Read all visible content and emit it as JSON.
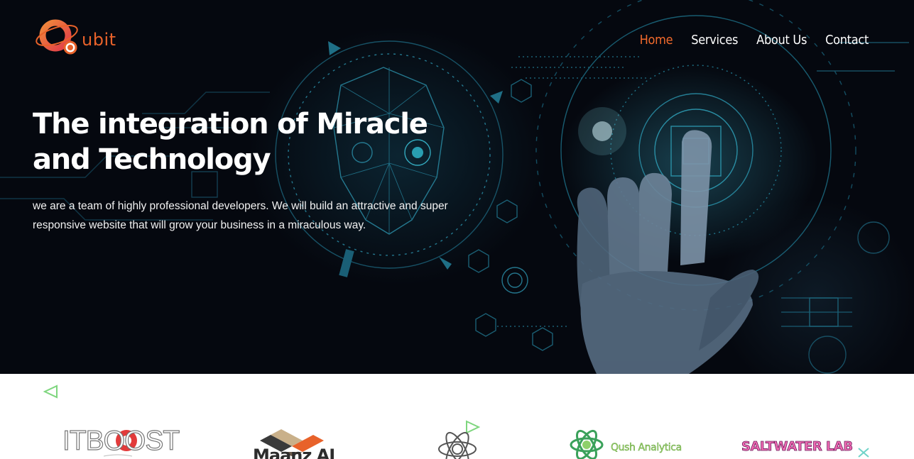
{
  "brand": {
    "name": "ubit",
    "color": "#e8622a"
  },
  "nav": {
    "items": [
      {
        "label": "Home",
        "active": true
      },
      {
        "label": "Services",
        "active": false
      },
      {
        "label": "About Us",
        "active": false
      },
      {
        "label": "Contact",
        "active": false
      }
    ],
    "active_color": "#f26a2c"
  },
  "hero": {
    "title": "The integration of Miracle and Technology",
    "description": "we are a team of highly professional developers. We will build an attractive and super responsive website that will grow your business in a miraculous way."
  },
  "clients": {
    "logos": [
      {
        "name": "ITBOOST",
        "icon": "itboost-logo"
      },
      {
        "name": "Maanz AI",
        "icon": "maanz-ai-logo"
      },
      {
        "name": "",
        "icon": "atom-logo"
      },
      {
        "name": "Qush Analytica",
        "icon": "qush-analytica-logo"
      },
      {
        "name": "SALTWATER LAB",
        "icon": "saltwater-lab-logo"
      }
    ]
  }
}
